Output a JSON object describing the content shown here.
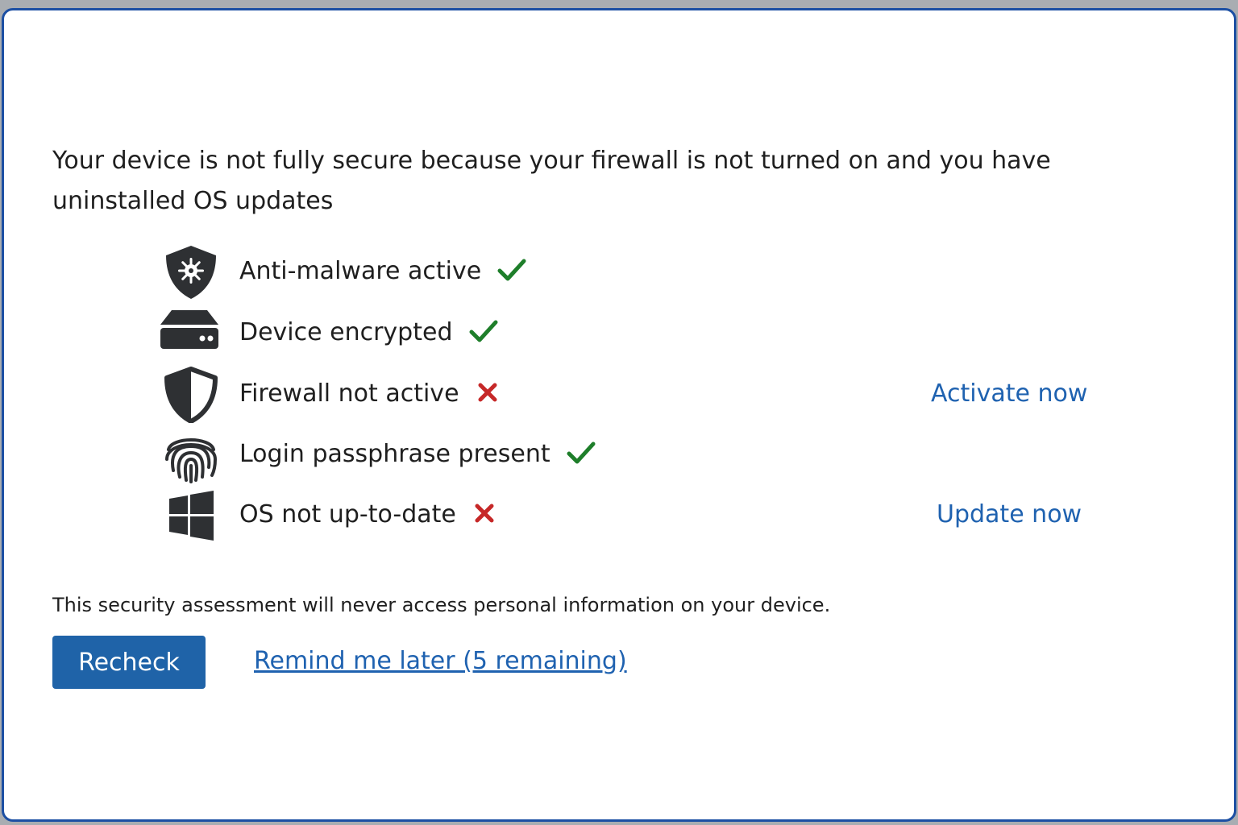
{
  "dialog": {
    "message": "Your device is not fully secure because your firewall is not turned on and you have uninstalled OS updates",
    "checks": [
      {
        "icon": "shield-malware-icon",
        "label": "Anti-malware active",
        "status": "pass"
      },
      {
        "icon": "drive-icon",
        "label": "Device encrypted",
        "status": "pass"
      },
      {
        "icon": "shield-icon",
        "label": "Firewall not active",
        "status": "fail",
        "action": "Activate now"
      },
      {
        "icon": "fingerprint-icon",
        "label": "Login passphrase present",
        "status": "pass"
      },
      {
        "icon": "windows-icon",
        "label": "OS not up-to-date",
        "status": "fail",
        "action": "Update now"
      }
    ],
    "privacy_note": "This security assessment will never access personal information on your device.",
    "recheck_label": "Recheck",
    "remind_label": "Remind me later (5 remaining)"
  },
  "colors": {
    "accent": "#1f63a8",
    "link": "#1f62b0",
    "pass": "#1e7e2a",
    "fail": "#c62828",
    "icon": "#2e3033",
    "border": "#1c4fa3"
  }
}
